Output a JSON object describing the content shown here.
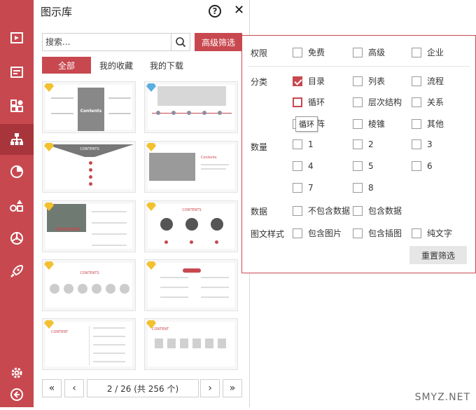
{
  "panel": {
    "title": "图示库",
    "help_icon": "?",
    "close_icon": "✕",
    "search_placeholder": "搜索...",
    "advanced_filter": "高级筛选",
    "tabs": [
      "全部",
      "我的收藏",
      "我的下载"
    ],
    "pagination": "2 / 26 (共 256 个)"
  },
  "thumbs": [
    {
      "badge": "gold",
      "label": "Contents"
    },
    {
      "badge": "blue",
      "label": ""
    },
    {
      "badge": "gold",
      "label": "CONTENTS"
    },
    {
      "badge": "gold",
      "label": "Contents"
    },
    {
      "badge": "gold",
      "label": "Contents"
    },
    {
      "badge": "gold",
      "label": "CONTENTS"
    },
    {
      "badge": "gold",
      "label": "CONTENTS"
    },
    {
      "badge": "gold",
      "label": ""
    },
    {
      "badge": "gold",
      "label": "CONTENT"
    },
    {
      "badge": "gold",
      "label": "CONTENT"
    }
  ],
  "filter": {
    "labels": {
      "permission": "权限",
      "category": "分类",
      "count": "数量",
      "data": "数据",
      "style": "图文样式"
    },
    "permission": [
      "免费",
      "高级",
      "企业"
    ],
    "category": [
      "目录",
      "列表",
      "流程",
      "循环",
      "层次结构",
      "关系",
      "矩阵",
      "棱锥",
      "其他"
    ],
    "count": [
      "1",
      "2",
      "3",
      "4",
      "5",
      "6",
      "7",
      "8"
    ],
    "data": [
      "不包含数据",
      "包含数据"
    ],
    "style": [
      "包含图片",
      "包含插图",
      "纯文字"
    ],
    "reset": "重置筛选",
    "tooltip": "循环"
  },
  "colors": {
    "accent": "#c8484f",
    "gold_badge": "#f2c12e",
    "blue_badge": "#5aaee0"
  },
  "watermark": "SMYZ.NET"
}
